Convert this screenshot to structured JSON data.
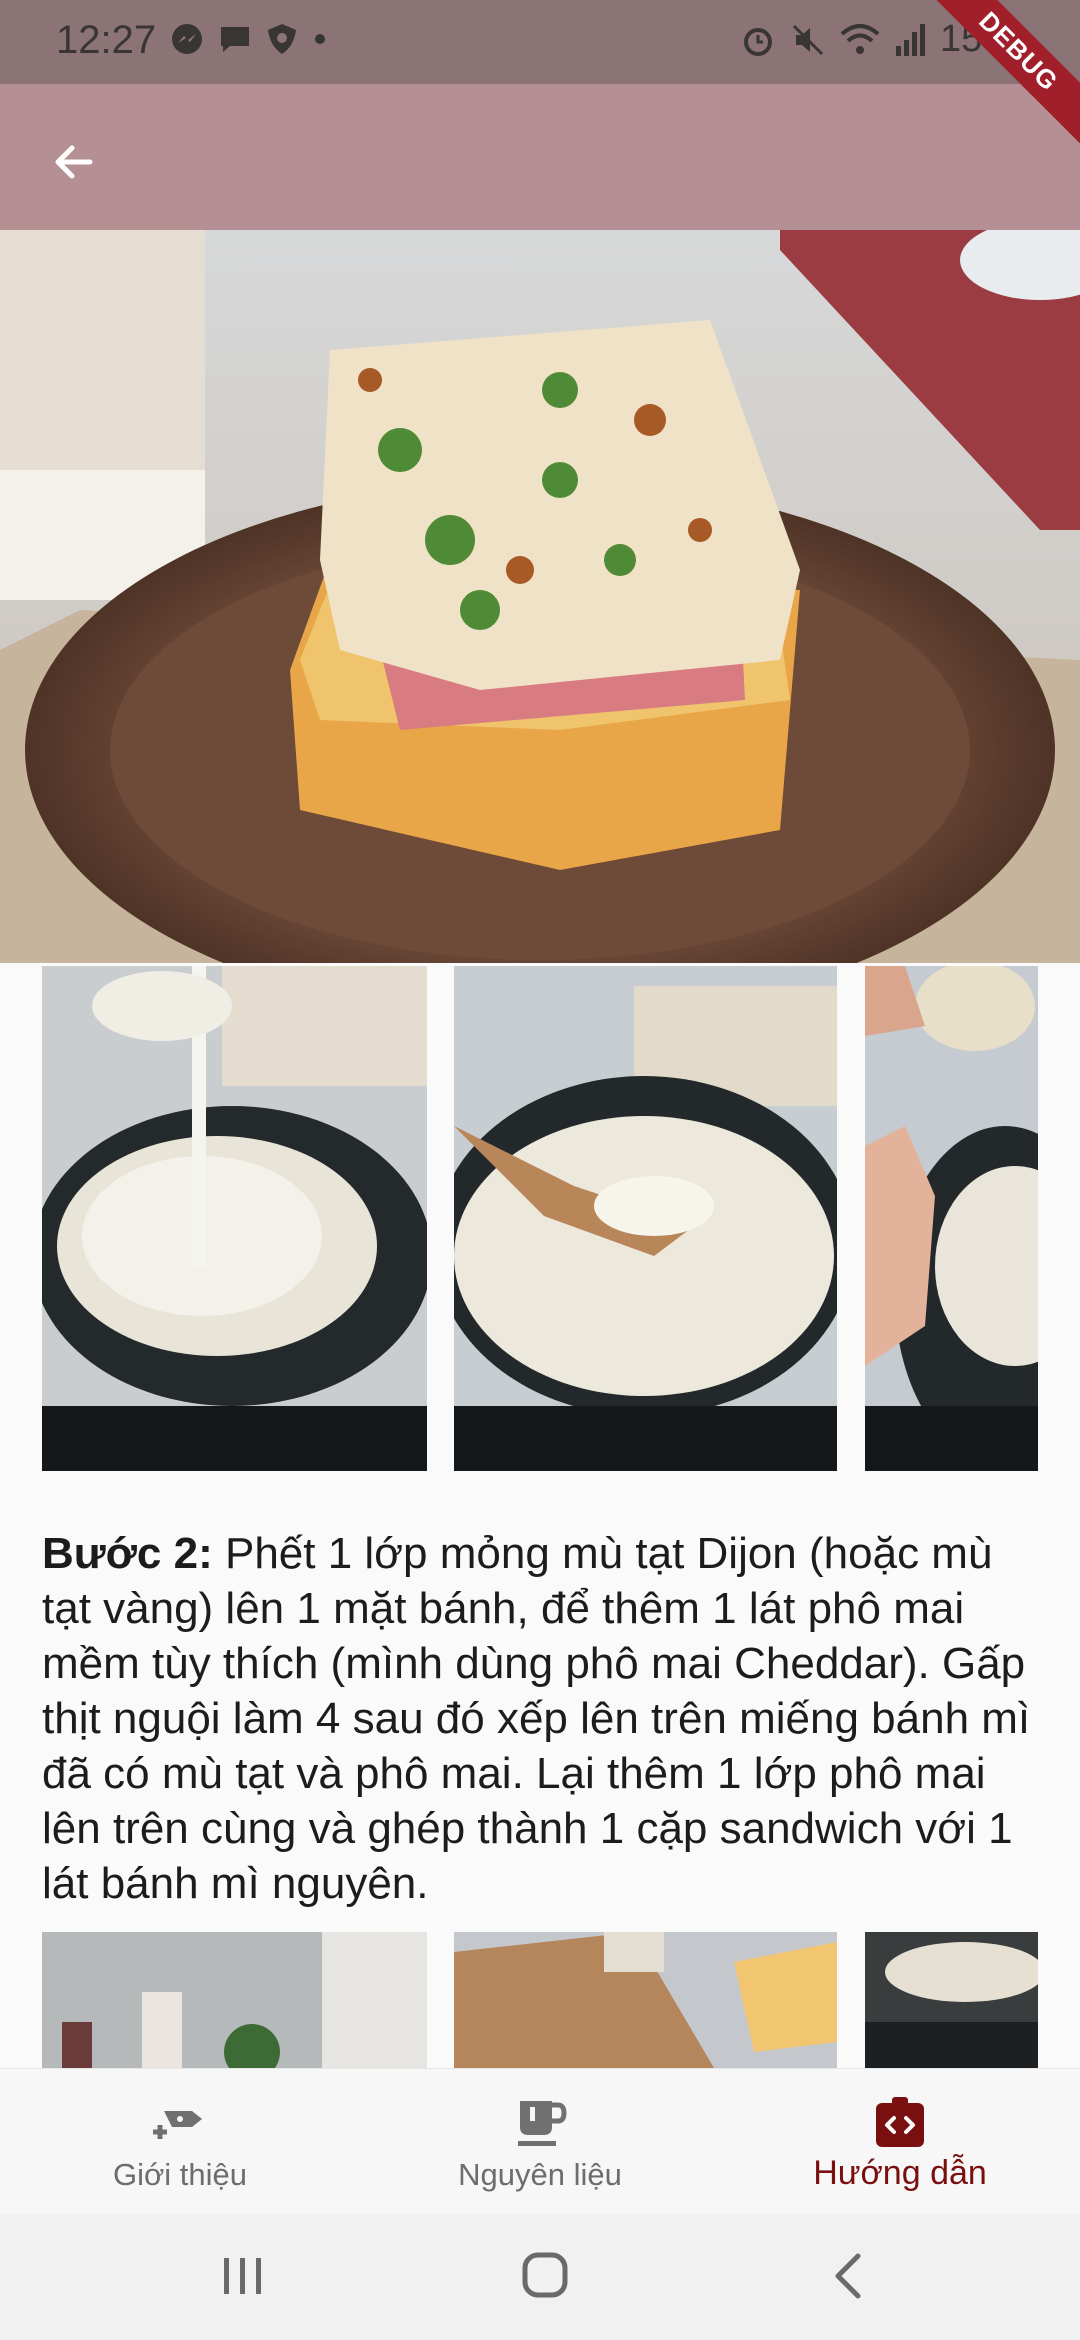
{
  "status": {
    "time": "12:27",
    "battery": "15%"
  },
  "appbar": {
    "debug_label": "DEBUG"
  },
  "step": {
    "label": "Bước 2:",
    "text": " Phết 1 lớp mỏng mù tạt Dijon (hoặc mù tạt vàng) lên 1 mặt bánh, để thêm 1 lát phô mai mềm tùy thích (mình dùng phô mai Cheddar). Gấp thịt nguội làm 4 sau đó xếp lên trên miếng bánh mì đã có mù tạt và phô mai. Lại thêm 1 lớp phô mai lên trên cùng và ghép thành 1 cặp sandwich với 1 lát bánh mì nguyên."
  },
  "bottom_nav": {
    "items": [
      {
        "label": "Giới thiệu",
        "icon": "food-intro-icon"
      },
      {
        "label": "Nguyên liệu",
        "icon": "cup-icon"
      },
      {
        "label": "Hướng dẫn",
        "icon": "code-guide-icon"
      }
    ],
    "active_index": 2
  },
  "colors": {
    "appbar": "#b48f93",
    "statusbar": "#8c7476",
    "active": "#7a0f10"
  }
}
